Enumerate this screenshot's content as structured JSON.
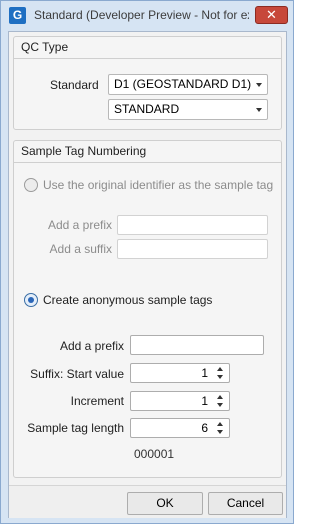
{
  "window": {
    "app_icon_letter": "G",
    "title": "Standard (Developer Preview - Not for ex",
    "close_glyph": "✕"
  },
  "qc_type": {
    "header": "QC Type",
    "standard_label": "Standard",
    "standard_value": "D1 (GEOSTANDARD D1)",
    "type_value": "STANDARD"
  },
  "sample_tag": {
    "header": "Sample Tag Numbering",
    "option_original": {
      "label": "Use the original identifier as the sample tag",
      "selected": false,
      "prefix_label": "Add a prefix",
      "suffix_label": "Add a suffix",
      "prefix_value": "",
      "suffix_value": ""
    },
    "option_anonymous": {
      "label": "Create anonymous sample tags",
      "selected": true,
      "prefix_label": "Add a prefix",
      "prefix_value": "",
      "start_label": "Suffix: Start value",
      "start_value": "1",
      "increment_label": "Increment",
      "increment_value": "1",
      "length_label": "Sample tag length",
      "length_value": "6",
      "preview": "000001"
    }
  },
  "footer": {
    "ok_label": "OK",
    "cancel_label": "Cancel"
  },
  "colors": {
    "title_bar": "#d6e4f3",
    "close_button": "#c7483a",
    "app_icon": "#1f6fc2",
    "radio_selected": "#2a66b8"
  }
}
